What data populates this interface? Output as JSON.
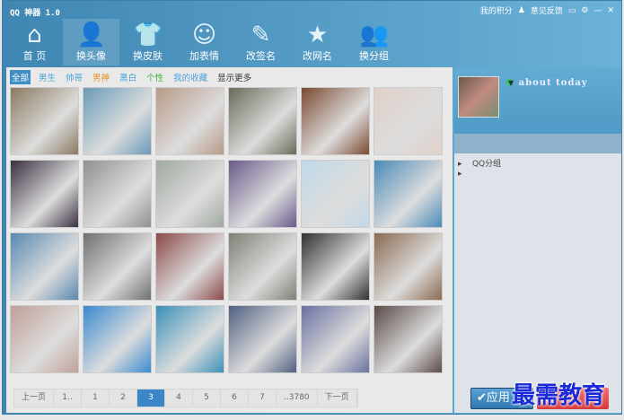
{
  "window": {
    "title": "QQ 神器 1.0",
    "points": "我的积分",
    "feedback": "意见反馈"
  },
  "nav": [
    {
      "label": "首 页",
      "icon": "home-icon"
    },
    {
      "label": "换头像",
      "icon": "avatar-icon"
    },
    {
      "label": "换皮肤",
      "icon": "shirt-icon"
    },
    {
      "label": "加表情",
      "icon": "smiley-icon"
    },
    {
      "label": "改签名",
      "icon": "pen-tag-icon"
    },
    {
      "label": "改网名",
      "icon": "star-icon"
    },
    {
      "label": "换分组",
      "icon": "group-icon"
    }
  ],
  "active_nav": 1,
  "categories": [
    {
      "label": "全部",
      "color": "#fff"
    },
    {
      "label": "男生",
      "color": "#49a3d6"
    },
    {
      "label": "帅哥",
      "color": "#49a3d6"
    },
    {
      "label": "男神",
      "color": "#e89020"
    },
    {
      "label": "黑白",
      "color": "#49a3d6"
    },
    {
      "label": "个性",
      "color": "#3bab3b"
    },
    {
      "label": "我的收藏",
      "color": "#49a3d6"
    },
    {
      "label": "显示更多",
      "color": "#333"
    }
  ],
  "photo_colors": [
    "#8a7a60",
    "#6a9ab8",
    "#b89a88",
    "#6a6a5a",
    "#7a4a30",
    "#e0d0c8",
    "#3a3040",
    "#909090",
    "#a0a8a0",
    "#6a5a8a",
    "#c0d8e8",
    "#4a8ab8",
    "#5a88b0",
    "#707070",
    "#8a4a48",
    "#808078",
    "#303030",
    "#8a6a50",
    "#c0a098",
    "#3a8ad0",
    "#3a90b8",
    "#506080",
    "#6a70a0",
    "#5a4a48"
  ],
  "pager": {
    "prev": "上一页",
    "pages": [
      "1..",
      "1",
      "2",
      "3",
      "4",
      "5",
      "6",
      "7",
      "..3780"
    ],
    "current": "3",
    "next": "下一页"
  },
  "profile": {
    "nickname": "about today"
  },
  "groups": [
    "QQ分组",
    ""
  ],
  "apply_button": "✔应用",
  "watermark": "最需教育"
}
